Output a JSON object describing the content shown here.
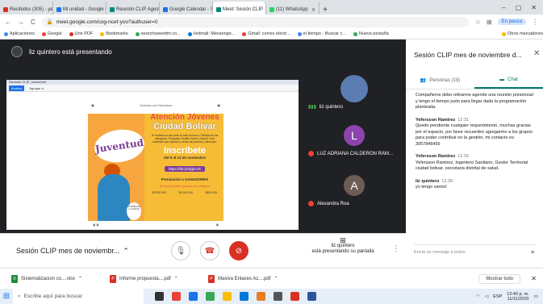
{
  "browser": {
    "tabs": [
      {
        "label": "Recibidos (305) - yeeri",
        "color": "#d93025"
      },
      {
        "label": "Mi unidad - Google Dr",
        "color": "#1a73e8"
      },
      {
        "label": "Reunión CLIP Agosto",
        "color": "#00897b"
      },
      {
        "label": "Google Calendar - Se",
        "color": "#1a73e8"
      },
      {
        "label": "Meet: Sesión CLIP",
        "color": "#00897b",
        "active": true
      },
      {
        "label": "(11) WhatsApp",
        "color": "#25d366"
      }
    ],
    "new_tab": "+",
    "window_controls": {
      "minimize": "–",
      "maximize": "▢",
      "close": "✕"
    },
    "url": "meet.google.com/cog-ncef-yoo?authuser=0",
    "profile": "En pausa",
    "bookmarks": [
      "Aplicaciones",
      "Google",
      "Unir PDF",
      "Bookmarks",
      "searchsweettm.co...",
      "Hotmail: Messenge...",
      "Gmail: correo electr...",
      "el tiempo - Buscar c...",
      "Nueva pestaña",
      "Otros marcadores"
    ]
  },
  "meeting": {
    "presenter_label": "liz quintero está presentando",
    "title": "Sesión CLIP mes de noviembr...",
    "presenting_text": "liz quintero\nestá presentando su pantalla",
    "participants": [
      {
        "name": "liz quintero",
        "initial": "",
        "color": "#5b7db1",
        "muted": false
      },
      {
        "name": "LUZ ADRIANA CALDERON RAM...",
        "initial": "L",
        "color": "#8e44ad",
        "muted": true
      },
      {
        "name": "Alexandra Roa",
        "initial": "A",
        "color": "#6d5d55",
        "muted": true
      }
    ]
  },
  "shared_screen": {
    "window_caption": "Revisión CLIP_noviembre",
    "toolbar": [
      "Archivo",
      "Agregar a"
    ],
    "poster": {
      "brand": "Juventud",
      "event_tag": "Jóvenes con Derechos",
      "heading1": "Atención Jóvenes",
      "heading2": "Ciudad Bolívar",
      "body": "Te invitamos a ser parte de este concurso. Participa en las categorías: Fotografía, Graffiti, Teatro y Danza. Crea contenido que exprese tu visión de juventud y derechos.",
      "cta": "Inscríbete",
      "dates": "del 5 al 13 de noviembre",
      "link": "https://bit.ly/3jqhcJX",
      "promo": "Premiación a GANADORES",
      "promo_sub": "de los 3 primeros puestos por categoría",
      "prizes": [
        "$2'000.000",
        "$1.000.000",
        "$500.000"
      ],
      "flyer": "JÓVENES EN LA CIUDAD"
    }
  },
  "chat_panel": {
    "title": "Sesión CLIP mes de noviembre d...",
    "people_tab": "Personas (19)",
    "chat_tab": "Chat",
    "messages": [
      {
        "sender": "",
        "time": "",
        "text": "Compañeros debo retirarme agende una reunión presencial y tengo el tiempo justo para llegar dada la programación planteada."
      },
      {
        "sender": "Yefersson Ramirez",
        "time": "12:31",
        "text": "Quedo pendiente cualquier requerimiento, muchas gracias por el espacio, por favor recuerden agregarme a los grupos para poder contribuir en la gestión, mi contacto es 3057846455"
      },
      {
        "sender": "Yefersson Ramirez",
        "time": "12:33",
        "text": "Yefersson Ramirez, Ingeniero Sanitario, Gestor Territorial ciudad bolivar, secretaria distrital de salud."
      },
      {
        "sender": "liz quintero",
        "time": "12:39",
        "text": "yo tengo varios!"
      }
    ],
    "input_placeholder": "Envía un mensaje a todos"
  },
  "downloads": {
    "items": [
      {
        "name": "Sistematizacion co....xlsx",
        "color": "#1e8e3e"
      },
      {
        "name": "Informe propuesta....pdf",
        "color": "#d93025"
      },
      {
        "name": "Masiva Enlaces Az....pdf",
        "color": "#d93025"
      }
    ],
    "show_all": "Mostrar todo"
  },
  "taskbar": {
    "search_placeholder": "Escribe aquí para buscar",
    "time": "12:40 p. m.",
    "date": "11/11/2020",
    "lang": "ESP",
    "app_colors": [
      "#333",
      "#ea4335",
      "#1a73e8",
      "#34a853",
      "#fbbc04",
      "#0078d7",
      "#e67e22",
      "#555",
      "#d93025",
      "#2b579a"
    ]
  }
}
